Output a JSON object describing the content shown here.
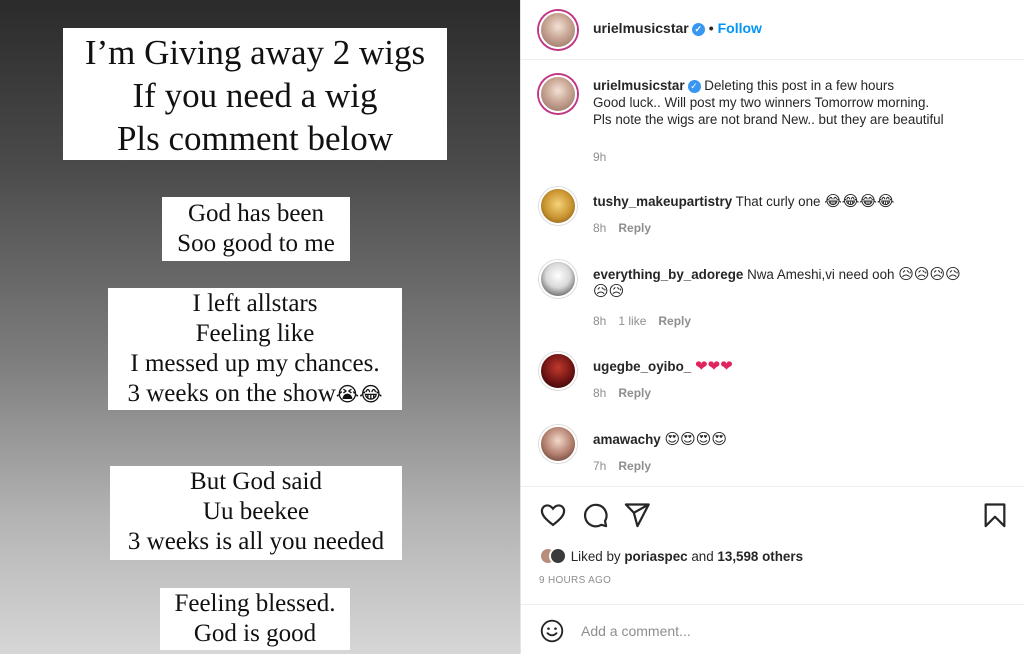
{
  "story": {
    "cards": [
      {
        "lines": [
          "I’m Giving away 2 wigs",
          "If you need a wig",
          "Pls comment below"
        ]
      },
      {
        "lines": [
          "God has been",
          "Soo good to me"
        ]
      },
      {
        "lines": [
          "I left allstars",
          "Feeling like",
          "I messed up my chances.",
          "3 weeks on the show"
        ],
        "emoji": "😭😂"
      },
      {
        "lines": [
          "But God said",
          "Uu beekee",
          "3 weeks is all you needed"
        ]
      },
      {
        "lines": [
          "Feeling blessed.",
          "God is good"
        ]
      }
    ]
  },
  "post": {
    "username": "urielmusicstar",
    "verified_badge": "✓",
    "separator": "•",
    "follow_label": "Follow",
    "caption": {
      "username": "urielmusicstar",
      "lines": [
        "Deleting this post in a few hours",
        "Good luck.. Will post my two winners Tomorrow morning.",
        "Pls note the wigs are not brand New.. but they are beautiful"
      ],
      "time": "9h"
    },
    "comments": [
      {
        "username": "tushy_makeupartistry",
        "text": "That curly one",
        "emoji": "😂😂😂😂",
        "time": "8h",
        "likes": "",
        "reply": "Reply"
      },
      {
        "username": "everything_by_adorege",
        "text": "Nwa Ameshi,vi need ooh",
        "emoji": "😥😥😥😥",
        "emoji2": "😥😥",
        "time": "8h",
        "likes": "1 like",
        "reply": "Reply"
      },
      {
        "username": "ugegbe_oyibo_",
        "text": "",
        "emoji": "❤❤❤",
        "time": "8h",
        "likes": "",
        "reply": "Reply"
      },
      {
        "username": "amawachy",
        "text": "",
        "emoji": "😍😍😍😍",
        "time": "7h",
        "likes": "",
        "reply": "Reply"
      }
    ],
    "likes_prefix": "Liked by",
    "likes_user": "poriaspec",
    "likes_and": "and",
    "likes_others": "13,598 others",
    "posted_time": "9 HOURS AGO",
    "add_comment_placeholder": "Add a comment..."
  },
  "colors": {
    "accent": "#0095f6",
    "heart": "#e0245e",
    "muted": "#8e8e8e"
  },
  "icons": [
    "heart-icon",
    "comment-icon",
    "share-icon",
    "bookmark-icon",
    "emoji-icon"
  ]
}
